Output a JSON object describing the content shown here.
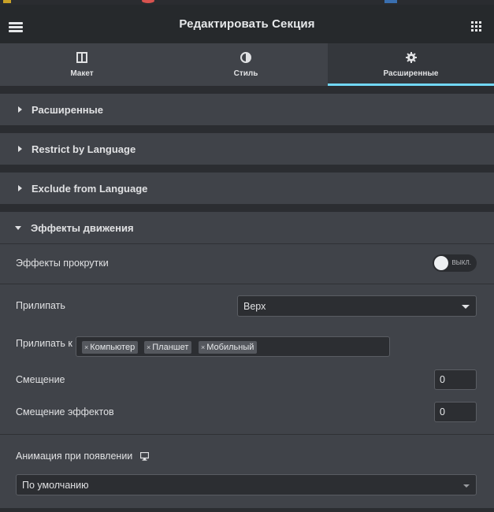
{
  "header": {
    "title": "Редактировать Секция"
  },
  "tabs": [
    {
      "label": "Макет",
      "icon": "layout-icon",
      "active": false
    },
    {
      "label": "Стиль",
      "icon": "contrast-icon",
      "active": false
    },
    {
      "label": "Расширенные",
      "icon": "gear-icon",
      "active": true
    }
  ],
  "sections": [
    {
      "title": "Расширенные",
      "expanded": false
    },
    {
      "title": "Restrict by Language",
      "expanded": false
    },
    {
      "title": "Exclude from Language",
      "expanded": false
    },
    {
      "title": "Эффекты движения",
      "expanded": true
    }
  ],
  "motion": {
    "scroll_effects_label": "Эффекты прокрутки",
    "scroll_effects_toggle": "ВЫКЛ.",
    "sticky_label": "Прилипать",
    "sticky_value": "Верх",
    "sticky_on_label": "Прилипать к",
    "sticky_on_tags": [
      "Компьютер",
      "Планшет",
      "Мобильный"
    ],
    "offset_label": "Смещение",
    "offset_value": "0",
    "effects_offset_label": "Смещение эффектов",
    "effects_offset_value": "0",
    "entrance_animation_label": "Анимация при появлении",
    "entrance_animation_value": "По умолчанию"
  },
  "colors": {
    "accent": "#71d7f7",
    "panel": "#404349",
    "header": "#26292c"
  }
}
